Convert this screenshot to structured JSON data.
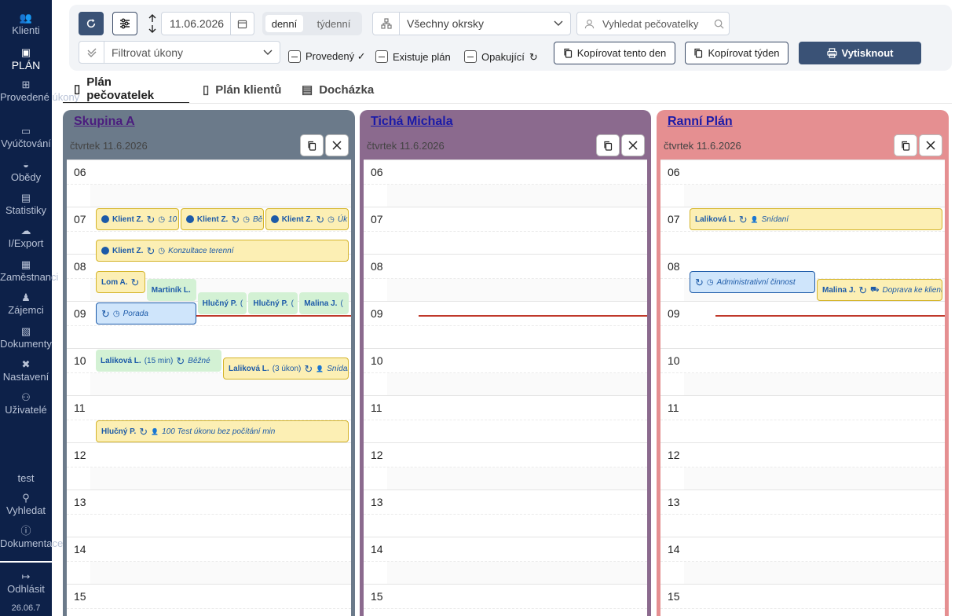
{
  "sidebar": {
    "items": [
      {
        "label": "Klienti",
        "icon": "users-icon"
      },
      {
        "label": "PLÁN",
        "icon": "calendar-icon"
      },
      {
        "label": "Provedené úkony",
        "icon": "table-icon"
      },
      {
        "label": "Vyúčtování",
        "icon": "money-icon"
      },
      {
        "label": "Obědy",
        "icon": "meal-icon"
      },
      {
        "label": "Statistiky",
        "icon": "stats-icon"
      },
      {
        "label": "I/Export",
        "icon": "cloud-icon"
      },
      {
        "label": "Zaměstnanci",
        "icon": "id-badge-icon"
      },
      {
        "label": "Zájemci",
        "icon": "interest-icon"
      },
      {
        "label": "Dokumenty",
        "icon": "document-icon"
      },
      {
        "label": "Nastavení",
        "icon": "tools-icon"
      },
      {
        "label": "Uživatelé",
        "icon": "user-group-icon"
      }
    ],
    "user": "test",
    "search": "Vyhledat",
    "docs": "Dokumentace",
    "logout": "Odhlásit",
    "version": "26.06.7"
  },
  "toolbar": {
    "date": "11.06.2026",
    "view_day": "denní",
    "view_week": "týdenní",
    "district": "Všechny okrsky",
    "search_placeholder": "Vyhledat pečovatelky",
    "filter_placeholder": "Filtrovat úkony",
    "chk_done": "Provedený ✓",
    "chk_plan": "Existuje plán",
    "chk_repeat": "Opakující",
    "copy_day": "Kopírovat tento den",
    "copy_week": "Kopírovat týden",
    "print": "Vytisknout"
  },
  "tabs": [
    {
      "label": "Plán pečovatelek"
    },
    {
      "label": "Plán klientů"
    },
    {
      "label": "Docházka"
    }
  ],
  "columns": [
    {
      "title": "Skupina A",
      "date": "čtvrtek 11.6.2026",
      "color": "#6b7a8a",
      "title_color": "#4b1d7e",
      "events": [
        {
          "name": "Klient Z.",
          "detail": "10",
          "style": "y",
          "icons": "dot-rep-clock",
          "hour": 7,
          "offset": 0,
          "lane": [
            0,
            0.333
          ]
        },
        {
          "name": "Klient Z.",
          "detail": "Bě",
          "style": "y",
          "icons": "dot-rep-clock",
          "hour": 7,
          "offset": 0,
          "lane": [
            0.333,
            0.666
          ]
        },
        {
          "name": "Klient Z.",
          "detail": "Úk",
          "style": "y",
          "icons": "dot-rep-clock",
          "hour": 7,
          "offset": 0,
          "lane": [
            0.666,
            1
          ]
        },
        {
          "name": "Klient Z.",
          "detail": "Konzultace terenní",
          "style": "y",
          "icons": "dot-rep-clock",
          "hour": 7,
          "offset": 40,
          "lane": [
            0,
            1
          ]
        },
        {
          "name": "Lom A.",
          "detail": "",
          "style": "y",
          "icons": "rep",
          "hour": 8,
          "offset": 20,
          "lane": [
            0,
            0.2
          ]
        },
        {
          "name": "Martiník L.",
          "detail": "",
          "style": "g",
          "icons": "",
          "hour": 8,
          "offset": 30,
          "lane": [
            0.2,
            0.4
          ]
        },
        {
          "name": "Hlučný P.",
          "detail": "(",
          "style": "g",
          "icons": "",
          "hour": 8,
          "offset": 47,
          "lane": [
            0.4,
            0.6
          ]
        },
        {
          "name": "Hlučný P.",
          "detail": "(",
          "style": "g",
          "icons": "",
          "hour": 8,
          "offset": 47,
          "lane": [
            0.6,
            0.8
          ]
        },
        {
          "name": "Malina J.",
          "detail": "(",
          "style": "g",
          "icons": "",
          "hour": 8,
          "offset": 47,
          "lane": [
            0.8,
            1
          ]
        },
        {
          "name": "",
          "detail": "Porada",
          "style": "b",
          "icons": "rep-clock",
          "hour": 9,
          "offset": 0,
          "lane": [
            0,
            0.4
          ]
        },
        {
          "name": "Laliková L.",
          "detail": "(15 min)",
          "extra": "Běžné",
          "style": "g",
          "icons": "rep",
          "hour": 10,
          "offset": 0,
          "lane": [
            0,
            0.5
          ]
        },
        {
          "name": "Laliková L.",
          "detail": "(3 úkon)",
          "extra": "Snídar",
          "style": "y",
          "icons": "rep-person",
          "hour": 10,
          "offset": 10,
          "lane": [
            0.5,
            1
          ]
        },
        {
          "name": "Hlučný P.",
          "detail": "100 Test úkonu bez počítání min",
          "style": "y",
          "icons": "rep-person",
          "hour": 11,
          "offset": 30,
          "lane": [
            0,
            1
          ]
        }
      ]
    },
    {
      "title": "Tichá Michala",
      "date": "čtvrtek 11.6.2026",
      "color": "#8b6a8e",
      "title_color": "#1a1aa8",
      "events": []
    },
    {
      "title": "Ranní Plán",
      "date": "čtvrtek 11.6.2026",
      "color": "#e58f91",
      "title_color": "#1a1aa8",
      "events": [
        {
          "name": "Laliková L.",
          "detail": "Snídaní",
          "style": "y",
          "icons": "rep-person",
          "hour": 7,
          "offset": 0,
          "lane": [
            0,
            1
          ]
        },
        {
          "name": "",
          "detail": "Administrativní činnost",
          "style": "b",
          "icons": "rep-clock",
          "hour": 8,
          "offset": 20,
          "lane": [
            0,
            0.5
          ]
        },
        {
          "name": "Malina J.",
          "detail": "Doprava ke klient",
          "style": "y",
          "icons": "rep-car",
          "hour": 8,
          "offset": 30,
          "lane": [
            0.5,
            1
          ]
        }
      ]
    }
  ],
  "hours": [
    "06",
    "07",
    "08",
    "09",
    "10",
    "11",
    "12",
    "13",
    "14",
    "15"
  ],
  "now_hour": 9.3
}
